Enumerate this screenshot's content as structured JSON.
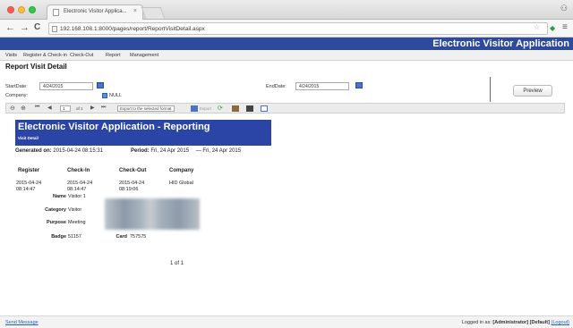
{
  "browser": {
    "tab_title": "Electronic Visitor Applica...",
    "tab_close": "×",
    "url": "192.168.108.1:8000/pages/report/ReportVisitDetail.aspx",
    "nav_back": "←",
    "nav_forward": "→",
    "nav_reload": "C",
    "star": "☆",
    "menu": "≡",
    "user": "⚇"
  },
  "app": {
    "title": "Electronic Visitor Application",
    "nav": [
      "Visits",
      "Register & Check-in",
      "Check-Out",
      "Report",
      "Management"
    ]
  },
  "page": {
    "title": "Report Visit Detail"
  },
  "filters": {
    "start_label": "StartDate:",
    "start_value": "4/24/2015",
    "end_label": "EndDate:",
    "end_value": "4/24/2015",
    "company_label": "Company:",
    "null_label": "NULL",
    "preview_label": "Preview"
  },
  "report_toolbar": {
    "first": "⏮",
    "prev": "◀",
    "page_value": "1",
    "of_label": "of 1",
    "next": "▶",
    "last": "⏭",
    "export_select": "Export to the selected format",
    "export_label": "Export"
  },
  "report": {
    "title": "Electronic Visitor Application - Reporting",
    "subtitle": "Visit Detail",
    "generated_label": "Generated on:",
    "generated_value": "2015-04-24 08:15:31",
    "period_label": "Period:",
    "period_from": "Fri, 24 Apr 2015",
    "period_dash": "—",
    "period_to": "Fri, 24 Apr 2015",
    "columns": [
      "Register",
      "Check-In",
      "Check-Out",
      "Company"
    ],
    "row": {
      "register": [
        "2015-04-24",
        "08:14:47"
      ],
      "checkin": [
        "2015-04-24",
        "08:14:47"
      ],
      "checkout": [
        "2015-04-24",
        "08:19:06"
      ],
      "company": "HID Global"
    },
    "details": {
      "name_label": "Name",
      "name_value": "Visitor 1",
      "category_label": "Category",
      "category_value": "Visitor",
      "purpose_label": "Purpose",
      "purpose_value": "Meeting",
      "badge_label": "Badge",
      "badge_value": "51157",
      "card_label": "Card",
      "card_value": "757575"
    },
    "pager": "1 of 1"
  },
  "footer": {
    "send_message": "Send Message",
    "logged_in_as": "Logged in as:",
    "user": "[Administrator]",
    "profile": "[Default]",
    "logout": "(Logout)"
  },
  "colors": {
    "app_header": "#2e4a9c",
    "report_banner": "#2b45a6",
    "link": "#2a5ad0"
  }
}
